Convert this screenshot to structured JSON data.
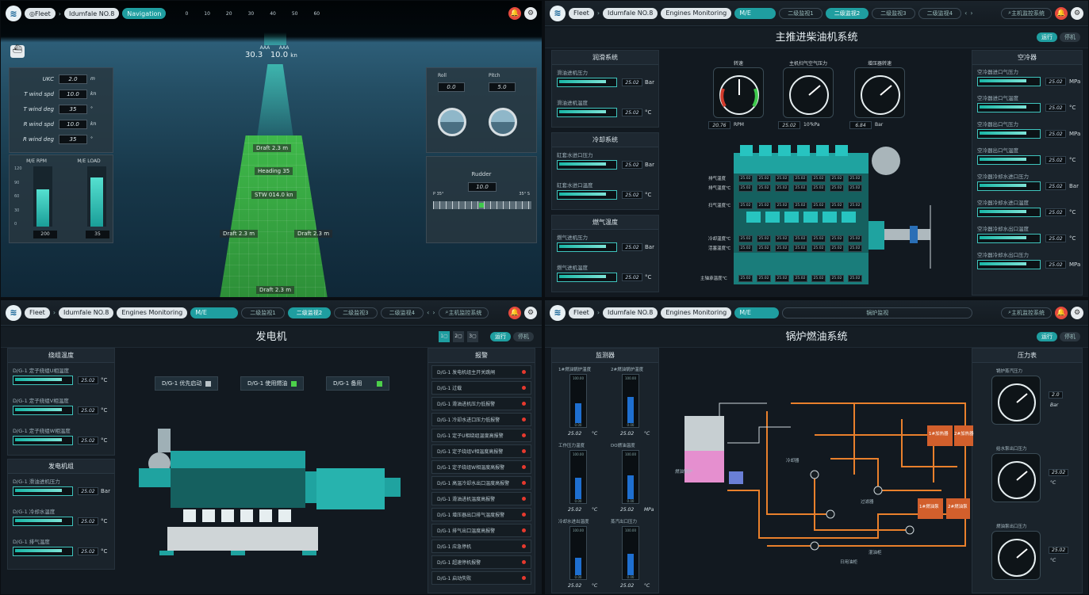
{
  "nav": {
    "fleet": "Fleet",
    "vessel": "Idumfale NO.8",
    "engines": "Engines Monitoring",
    "navigation": "Navigation",
    "mv": "M/E",
    "tabs": [
      "二级监视1",
      "二级监视2",
      "二级监视3",
      "二级监视4"
    ],
    "search": "主机监控系统"
  },
  "q1": {
    "compass_ticks": [
      "0",
      "10",
      "20",
      "30",
      "40",
      "50",
      "60"
    ],
    "heading_left": "30.3",
    "heading_right": "10.0",
    "heading_unit": "kn",
    "info_rows": [
      {
        "label": "UKC",
        "value": "2.0",
        "unit": "m"
      },
      {
        "label": "T wind spd",
        "value": "10.0",
        "unit": "kn"
      },
      {
        "label": "T wind deg",
        "value": "35",
        "unit": "°"
      },
      {
        "label": "R wind spd",
        "value": "10.0",
        "unit": "kn"
      },
      {
        "label": "R wind deg",
        "value": "35",
        "unit": "°"
      }
    ],
    "rpm_label": "M/E RPM",
    "load_label": "M/E LOAD",
    "rpm_value": "200",
    "load_value": "35",
    "rpm_level": 0.62,
    "load_level": 0.82,
    "rpm_ticks": [
      "120",
      "90",
      "60",
      "30",
      "0"
    ],
    "roll_label": "Roll",
    "pitch_label": "Pitch",
    "roll_value": "0.0",
    "pitch_value": "5.0",
    "rudder_label": "Rudder",
    "rudder_value": "10.0",
    "rudder_left": "P 35°",
    "rudder_right": "35° S",
    "draft_top": "Draft 2.3 m",
    "heading": "Heading 35",
    "stw": "STW 014.0 kn",
    "draft_left": "Draft 2.3 m",
    "draft_right": "Draft 2.3 m",
    "draft_bottom": "Draft 2.3 m"
  },
  "q2": {
    "title": "主推进柴油机系统",
    "toggle": [
      "运行",
      "停机"
    ],
    "left_sections": [
      {
        "title": "润滑系统",
        "items": [
          {
            "label": "滑油进机压力",
            "value": "25.02",
            "unit": "Bar"
          },
          {
            "label": "滑油进机温度",
            "value": "25.02",
            "unit": "°C"
          }
        ]
      },
      {
        "title": "冷却系统",
        "items": [
          {
            "label": "缸套水进口压力",
            "value": "25.02",
            "unit": "Bar"
          },
          {
            "label": "缸套水进口温度",
            "value": "25.02",
            "unit": "°C"
          }
        ]
      },
      {
        "title": "燃气温度",
        "items": [
          {
            "label": "燃气进机压力",
            "value": "25.02",
            "unit": "Bar"
          },
          {
            "label": "燃气进机温度",
            "value": "25.02",
            "unit": "°C"
          }
        ]
      }
    ],
    "gauges": [
      {
        "title": "转速",
        "value": "20.76",
        "unit": "RPM"
      },
      {
        "title": "主机扫气空气压力",
        "value": "25.02",
        "unit": "10³kPa"
      },
      {
        "title": "增压器转速",
        "value": "6.84",
        "unit": "Bar"
      }
    ],
    "row_labels": [
      "排气温度",
      "排气温度℃",
      "扫气温度℃",
      "冷却温度℃",
      "活塞温度℃",
      "主轴承温度℃"
    ],
    "right_title": "空冷器",
    "right_items": [
      {
        "label": "空冷器进口气压力",
        "value": "25.02",
        "unit": "MPa"
      },
      {
        "label": "空冷器进口气温度",
        "value": "25.02",
        "unit": "°C"
      },
      {
        "label": "空冷器出口气压力",
        "value": "25.02",
        "unit": "MPa"
      },
      {
        "label": "空冷器出口气温度",
        "value": "25.02",
        "unit": "°C"
      },
      {
        "label": "空冷器冷却水进口压力",
        "value": "25.02",
        "unit": "Bar"
      },
      {
        "label": "空冷器冷却水进口温度",
        "value": "25.02",
        "unit": "°C"
      },
      {
        "label": "空冷器冷却水出口温度",
        "value": "25.02",
        "unit": "°C"
      },
      {
        "label": "空冷器冷却水出口压力",
        "value": "25.02",
        "unit": "MPa"
      }
    ],
    "cell": "25.02"
  },
  "q3": {
    "title": "发电机",
    "toggle": [
      "运行",
      "停机"
    ],
    "left_sections": [
      {
        "title": "绕组温度",
        "items": [
          {
            "label": "D/G-1 定子绕组U相温度",
            "value": "25.02",
            "unit": "°C"
          },
          {
            "label": "D/G-1 定子绕组V相温度",
            "value": "25.02",
            "unit": "°C"
          },
          {
            "label": "D/G-1 定子绕组W相温度",
            "value": "25.02",
            "unit": "°C"
          }
        ]
      },
      {
        "title": "发电机组",
        "items": [
          {
            "label": "D/G-1 滑油进机压力",
            "value": "25.02",
            "unit": "Bar"
          },
          {
            "label": "D/G-1 冷却水温度",
            "value": "25.02",
            "unit": "°C"
          },
          {
            "label": "D/G-1 排气温度",
            "value": "25.02",
            "unit": "°C"
          }
        ]
      }
    ],
    "gen_buttons": [
      {
        "label": "D/G-1 优先启动",
        "on": false
      },
      {
        "label": "D/G-1 使用燃油",
        "on": true
      },
      {
        "label": "D/G-1 备用",
        "on": true
      }
    ],
    "alarm_title": "报警",
    "alarms": [
      "D/G-1 发电机组主开关跳闸",
      "D/G-1 过载",
      "D/G-1 滑油进机压力低报警",
      "D/G-1 冷却水进口压力低报警",
      "D/G-1 定子U相绕组温度高报警",
      "D/G-1 定子绕组V相温度高报警",
      "D/G-1 定子绕组W相温度高报警",
      "D/G-1 高温冷却水出口温度高报警",
      "D/G-1 滑油进机温度高报警",
      "D/G-1 增压器出口排气温度报警",
      "D/G-1 排气出口温度高报警",
      "D/G-1 应急停机",
      "D/G-1 超速停机报警",
      "D/G-1 启动失败"
    ]
  },
  "q4": {
    "title": "锅炉燃油系统",
    "nav_center": "锅炉监视",
    "toggle": [
      "运行",
      "停机"
    ],
    "left_title": "监测器",
    "therms": [
      {
        "label": "1#燃油锅炉温度",
        "value": "25.02",
        "unit": "°C",
        "level": 0.45
      },
      {
        "label": "2#燃油锅炉温度",
        "value": "25.02",
        "unit": "°C",
        "level": 0.6
      },
      {
        "label": "工作压力温度",
        "value": "25.02",
        "unit": "°C",
        "level": 0.5
      },
      {
        "label": "DO燃油温度",
        "value": "25.02",
        "unit": "MPa",
        "level": 0.55
      },
      {
        "label": "冷却水进出温度",
        "value": "25.02",
        "unit": "°C",
        "level": 0.4
      },
      {
        "label": "蒸汽出口压力",
        "value": "25.02",
        "unit": "°C",
        "level": 0.5
      }
    ],
    "therm_ticks": [
      "100.00",
      "0.00"
    ],
    "right_title": "压力表",
    "gauges": [
      {
        "label": "锅炉蒸汽压力",
        "value": "2.0",
        "unit": "Bar"
      },
      {
        "label": "给水泵出口压力",
        "value": "25.02",
        "unit": "°C"
      },
      {
        "label": "燃油泵出口压力",
        "value": "25.02",
        "unit": "°C"
      }
    ],
    "components": {
      "boiler": "燃油锅炉",
      "heater1": "1#加热器",
      "heater2": "2#加热器",
      "pump1": "1#燃油泵",
      "pump2": "2#燃油泵",
      "cooler": "冷却器",
      "filter": "过滤器",
      "tank": "日用油柜",
      "mixer": "混油柜"
    }
  },
  "colors": {
    "accent": "#1f9ea0",
    "alarm": "#e6392e",
    "ship": "#3fb94a",
    "orange": "#e9802c",
    "pipe": "#e9802c"
  }
}
